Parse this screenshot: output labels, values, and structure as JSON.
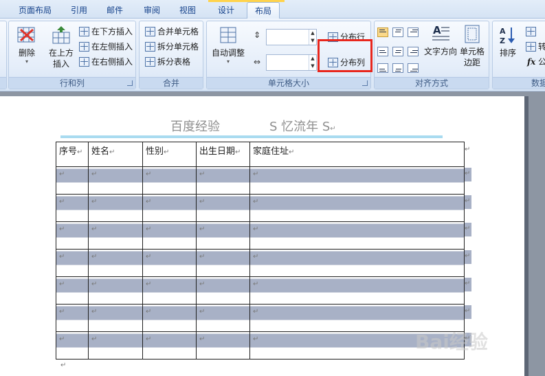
{
  "tabs": [
    {
      "label": "页面布局"
    },
    {
      "label": "引用"
    },
    {
      "label": "邮件"
    },
    {
      "label": "审阅"
    },
    {
      "label": "视图"
    },
    {
      "label": "设计"
    },
    {
      "label": "布局",
      "active": true
    }
  ],
  "ribbon": {
    "rows_cols": {
      "label": "行和列",
      "delete": "删除",
      "insert_above_line1": "在上方",
      "insert_above_line2": "插入",
      "insert_below": "在下方插入",
      "insert_left": "在左侧插入",
      "insert_right": "在右侧插入"
    },
    "merge": {
      "label": "合并",
      "merge_cells": "合并单元格",
      "split_cells": "拆分单元格",
      "split_table": "拆分表格"
    },
    "cell_size": {
      "label": "单元格大小",
      "autofit": "自动调整",
      "distribute_rows": "分布行",
      "distribute_cols": "分布列",
      "height_value": "",
      "width_value": ""
    },
    "alignment": {
      "label": "对齐方式",
      "text_direction": "文字方向",
      "cell_margins_line1": "单元格",
      "cell_margins_line2": "边距"
    },
    "data": {
      "label": "数据",
      "sort": "排序",
      "convert_partial": "转",
      "formula_partial": "公"
    }
  },
  "document": {
    "header_left": "百度经验",
    "header_right": "S 忆流年 S",
    "para_mark": "↵",
    "table": {
      "headers": [
        "序号",
        "姓名",
        "性别",
        "出生日期",
        "家庭住址"
      ],
      "rows": 7
    }
  },
  "watermark": "Bai经验",
  "colors": {
    "highlight": "#e8261c",
    "row_shading": "#a8b1c6",
    "tab_text": "#15428b"
  }
}
